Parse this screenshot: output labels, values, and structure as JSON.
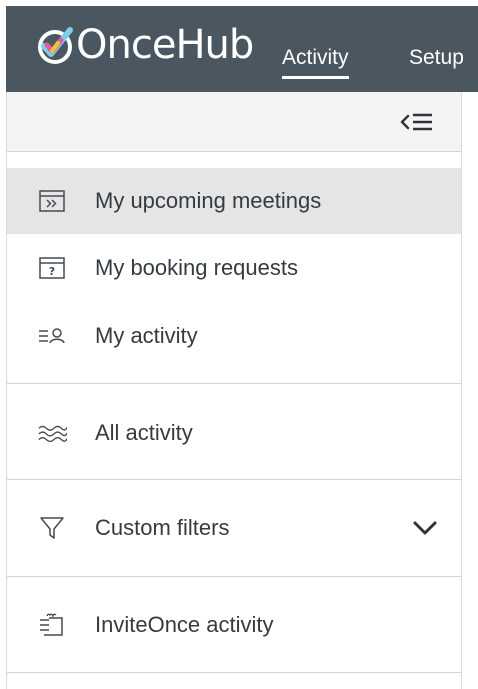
{
  "header": {
    "logo_text": "OnceHub",
    "brand_color": "#4a5660",
    "nav": [
      {
        "label": "Activity",
        "active": true
      },
      {
        "label": "Setup",
        "active": false
      }
    ]
  },
  "sidebar": {
    "collapse_icon": "collapse-menu-icon",
    "items": [
      {
        "label": "My upcoming meetings",
        "icon": "calendar-forward-icon",
        "selected": true
      },
      {
        "label": "My booking requests",
        "icon": "calendar-question-icon",
        "selected": false
      },
      {
        "label": "My activity",
        "icon": "list-person-icon",
        "selected": false
      },
      {
        "label": "All activity",
        "icon": "waves-icon",
        "selected": false
      },
      {
        "label": "Custom filters",
        "icon": "filter-icon",
        "selected": false
      },
      {
        "label": "InviteOnce activity",
        "icon": "invite-list-icon",
        "selected": false
      }
    ]
  }
}
